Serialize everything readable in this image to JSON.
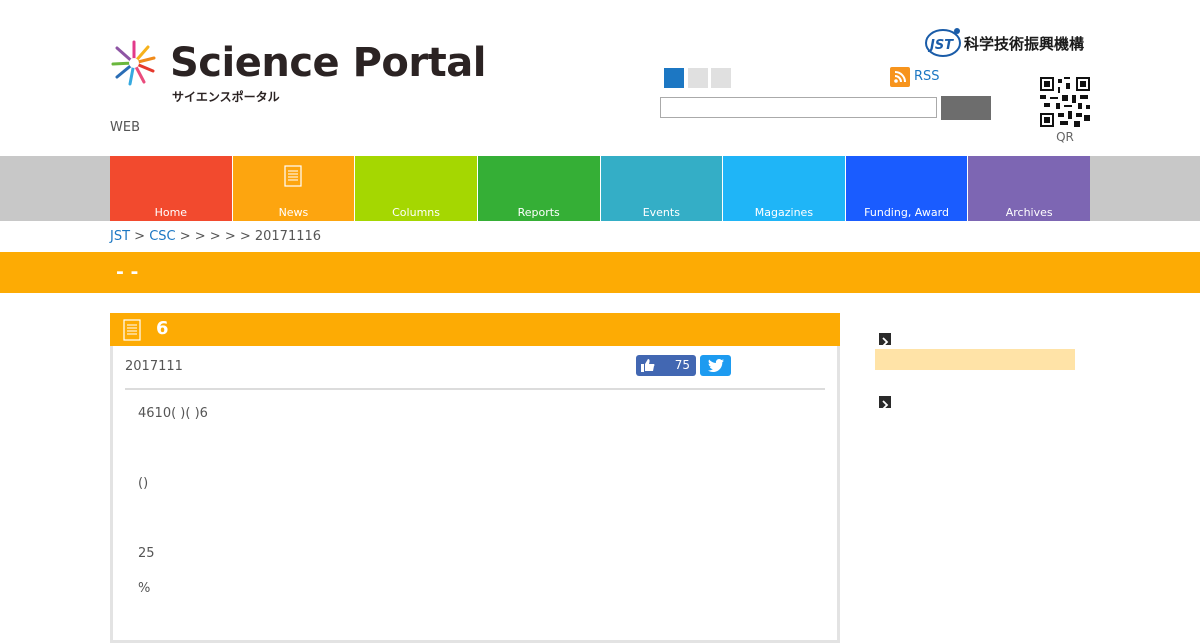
{
  "header": {
    "logo_title": "Science Portal",
    "logo_subtitle": "サイエンスポータル",
    "web_label": "WEB",
    "jst_logo_text": "科学技術振興機構",
    "rss_label": "RSS",
    "qr_label": "QR",
    "search": {
      "placeholder": "",
      "button_label": ""
    },
    "font_size_buttons": [
      {
        "color": "#1c77c3"
      },
      {
        "color": "#e0e0e0"
      },
      {
        "color": "#e0e0e0"
      }
    ]
  },
  "nav": {
    "items": [
      {
        "label": "Home",
        "color": "#f24a2e"
      },
      {
        "label": "News",
        "color": "#fda50f",
        "active": true
      },
      {
        "label": "Columns",
        "color": "#a5d701"
      },
      {
        "label": "Reports",
        "color": "#35af36"
      },
      {
        "label": "Events",
        "color": "#34aec6"
      },
      {
        "label": "Magazines",
        "color": "#1fb5f7"
      },
      {
        "label": "Funding, Award",
        "color": "#1a5cff"
      },
      {
        "label": "Archives",
        "color": "#7d66b3"
      }
    ]
  },
  "breadcrumb": {
    "links": [
      "JST",
      "CSC"
    ],
    "tail": " >  >  >       >  > 20171116",
    "sep": " > "
  },
  "banner": {
    "title": "- -"
  },
  "article": {
    "number": "6",
    "date": "2017111",
    "like_count": "75",
    "body": [
      "4610( )( )6",
      "()",
      "25",
      "%"
    ]
  },
  "colors": {
    "accent": "#fdab04",
    "link": "#1c77c3"
  }
}
